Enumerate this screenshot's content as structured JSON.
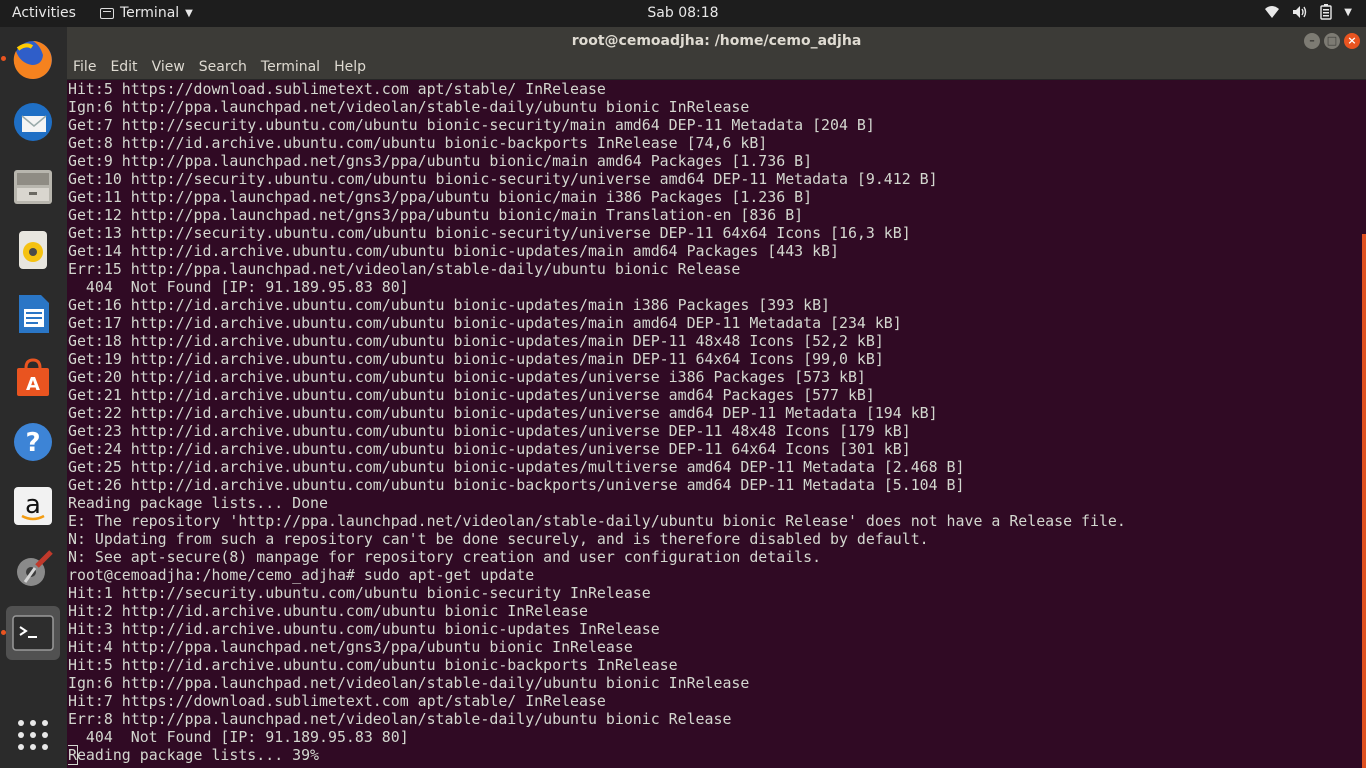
{
  "topbar": {
    "activities": "Activities",
    "app_name": "Terminal",
    "clock": "Sab 08:18"
  },
  "dock": {
    "items": [
      "Firefox",
      "Thunderbird",
      "Files",
      "Rhythmbox",
      "LibreOffice Writer",
      "Ubuntu Software",
      "Help",
      "Amazon",
      "System Settings",
      "Terminal",
      "Show Applications"
    ]
  },
  "window": {
    "title": "root@cemoadjha: /home/cemo_adjha",
    "menu": [
      "File",
      "Edit",
      "View",
      "Search",
      "Terminal",
      "Help"
    ]
  },
  "terminal": {
    "lines": [
      "Hit:5 https://download.sublimetext.com apt/stable/ InRelease",
      "Ign:6 http://ppa.launchpad.net/videolan/stable-daily/ubuntu bionic InRelease",
      "Get:7 http://security.ubuntu.com/ubuntu bionic-security/main amd64 DEP-11 Metadata [204 B]",
      "Get:8 http://id.archive.ubuntu.com/ubuntu bionic-backports InRelease [74,6 kB]",
      "Get:9 http://ppa.launchpad.net/gns3/ppa/ubuntu bionic/main amd64 Packages [1.736 B]",
      "Get:10 http://security.ubuntu.com/ubuntu bionic-security/universe amd64 DEP-11 Metadata [9.412 B]",
      "Get:11 http://ppa.launchpad.net/gns3/ppa/ubuntu bionic/main i386 Packages [1.236 B]",
      "Get:12 http://ppa.launchpad.net/gns3/ppa/ubuntu bionic/main Translation-en [836 B]",
      "Get:13 http://security.ubuntu.com/ubuntu bionic-security/universe DEP-11 64x64 Icons [16,3 kB]",
      "Get:14 http://id.archive.ubuntu.com/ubuntu bionic-updates/main amd64 Packages [443 kB]",
      "Err:15 http://ppa.launchpad.net/videolan/stable-daily/ubuntu bionic Release",
      "  404  Not Found [IP: 91.189.95.83 80]",
      "Get:16 http://id.archive.ubuntu.com/ubuntu bionic-updates/main i386 Packages [393 kB]",
      "Get:17 http://id.archive.ubuntu.com/ubuntu bionic-updates/main amd64 DEP-11 Metadata [234 kB]",
      "Get:18 http://id.archive.ubuntu.com/ubuntu bionic-updates/main DEP-11 48x48 Icons [52,2 kB]",
      "Get:19 http://id.archive.ubuntu.com/ubuntu bionic-updates/main DEP-11 64x64 Icons [99,0 kB]",
      "Get:20 http://id.archive.ubuntu.com/ubuntu bionic-updates/universe i386 Packages [573 kB]",
      "Get:21 http://id.archive.ubuntu.com/ubuntu bionic-updates/universe amd64 Packages [577 kB]",
      "Get:22 http://id.archive.ubuntu.com/ubuntu bionic-updates/universe amd64 DEP-11 Metadata [194 kB]",
      "Get:23 http://id.archive.ubuntu.com/ubuntu bionic-updates/universe DEP-11 48x48 Icons [179 kB]",
      "Get:24 http://id.archive.ubuntu.com/ubuntu bionic-updates/universe DEP-11 64x64 Icons [301 kB]",
      "Get:25 http://id.archive.ubuntu.com/ubuntu bionic-updates/multiverse amd64 DEP-11 Metadata [2.468 B]",
      "Get:26 http://id.archive.ubuntu.com/ubuntu bionic-backports/universe amd64 DEP-11 Metadata [5.104 B]",
      "Reading package lists... Done",
      "E: The repository 'http://ppa.launchpad.net/videolan/stable-daily/ubuntu bionic Release' does not have a Release file.",
      "N: Updating from such a repository can't be done securely, and is therefore disabled by default.",
      "N: See apt-secure(8) manpage for repository creation and user configuration details.",
      "root@cemoadjha:/home/cemo_adjha# sudo apt-get update",
      "Hit:1 http://security.ubuntu.com/ubuntu bionic-security InRelease",
      "Hit:2 http://id.archive.ubuntu.com/ubuntu bionic InRelease",
      "Hit:3 http://id.archive.ubuntu.com/ubuntu bionic-updates InRelease",
      "Hit:4 http://ppa.launchpad.net/gns3/ppa/ubuntu bionic InRelease",
      "Hit:5 http://id.archive.ubuntu.com/ubuntu bionic-backports InRelease",
      "Ign:6 http://ppa.launchpad.net/videolan/stable-daily/ubuntu bionic InRelease",
      "Hit:7 https://download.sublimetext.com apt/stable/ InRelease",
      "Err:8 http://ppa.launchpad.net/videolan/stable-daily/ubuntu bionic Release",
      "  404  Not Found [IP: 91.189.95.83 80]"
    ],
    "cursor_char": "R",
    "last_line_rest": "eading package lists... 39%"
  }
}
